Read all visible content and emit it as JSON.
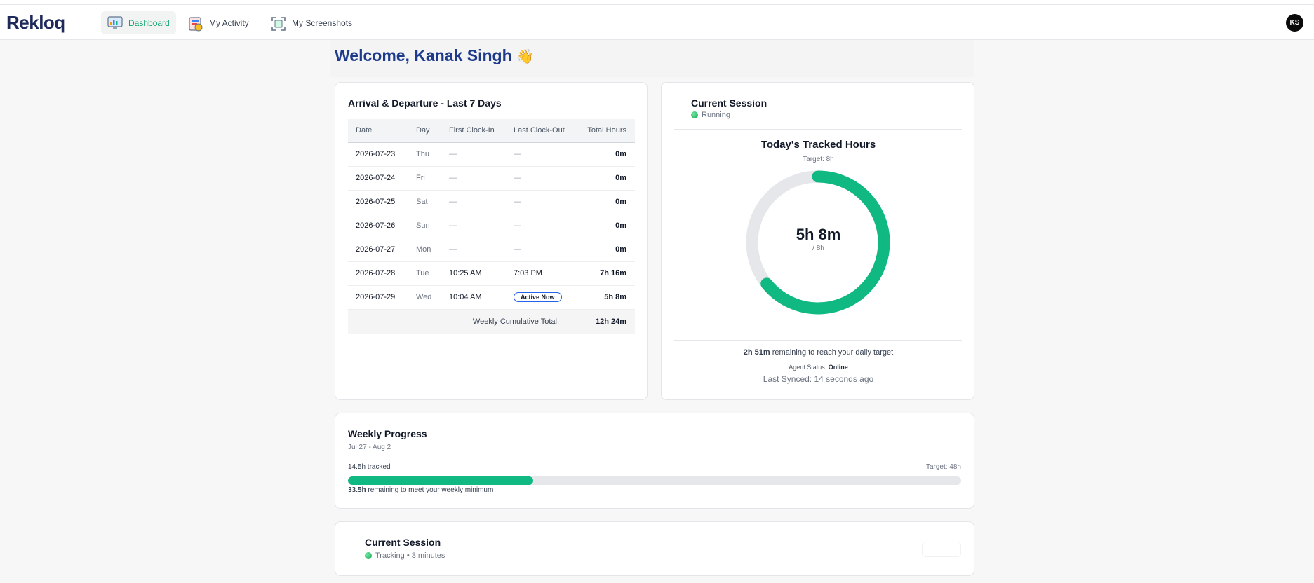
{
  "app": {
    "logo": "Rekloq"
  },
  "nav": {
    "items": [
      {
        "label": "Dashboard",
        "icon": "dashboard-icon",
        "active": true
      },
      {
        "label": "My Activity",
        "icon": "activity-icon",
        "active": false
      },
      {
        "label": "My Screenshots",
        "icon": "screenshots-icon",
        "active": false
      }
    ],
    "avatar_initials": "KS"
  },
  "welcome": {
    "title": "Welcome, Kanak Singh",
    "emoji": "👋"
  },
  "attendance": {
    "title": "Arrival & Departure - Last 7 Days",
    "columns": [
      "Date",
      "Day",
      "First Clock-In",
      "Last Clock-Out",
      "Total Hours"
    ],
    "rows": [
      {
        "date": "2026-07-23",
        "day": "Thu",
        "clock_in": "—",
        "clock_out": "—",
        "total": "0m"
      },
      {
        "date": "2026-07-24",
        "day": "Fri",
        "clock_in": "—",
        "clock_out": "—",
        "total": "0m"
      },
      {
        "date": "2026-07-25",
        "day": "Sat",
        "clock_in": "—",
        "clock_out": "—",
        "total": "0m"
      },
      {
        "date": "2026-07-26",
        "day": "Sun",
        "clock_in": "—",
        "clock_out": "—",
        "total": "0m"
      },
      {
        "date": "2026-07-27",
        "day": "Mon",
        "clock_in": "—",
        "clock_out": "—",
        "total": "0m"
      },
      {
        "date": "2026-07-28",
        "day": "Tue",
        "clock_in": "10:25 AM",
        "clock_out": "7:03 PM",
        "total": "7h 16m"
      },
      {
        "date": "2026-07-29",
        "day": "Wed",
        "clock_in": "10:04 AM",
        "clock_out": "Active Now",
        "total": "5h 8m"
      }
    ],
    "total_label": "Weekly Cumulative Total:",
    "total_value": "12h 24m"
  },
  "current_session": {
    "title": "Current Session",
    "status": "Running",
    "tracked_title": "Today's Tracked Hours",
    "target": "Target: 8h",
    "value": "5h 8m",
    "of": "/ 8h",
    "progress_fraction": 0.642,
    "remaining_bold": "2h 51m",
    "remaining_text": "remaining to reach your daily target",
    "agent_status_label": "Agent Status:",
    "agent_status_value": "Online",
    "last_synced": "Last Synced: 14 seconds ago"
  },
  "weekly": {
    "title": "Weekly Progress",
    "range": "Jul 27 - Aug 2",
    "tracked": "14.5h tracked",
    "target": "Target: 48h",
    "progress_fraction": 0.302,
    "remaining_bold": "33.5h",
    "remaining_text": "remaining to meet your weekly minimum"
  },
  "session2": {
    "title": "Current Session",
    "status": "Tracking • 3 minutes"
  },
  "colors": {
    "accent": "#10b981",
    "brand": "#1e3a8a",
    "ring_track": "#e5e7eb"
  }
}
